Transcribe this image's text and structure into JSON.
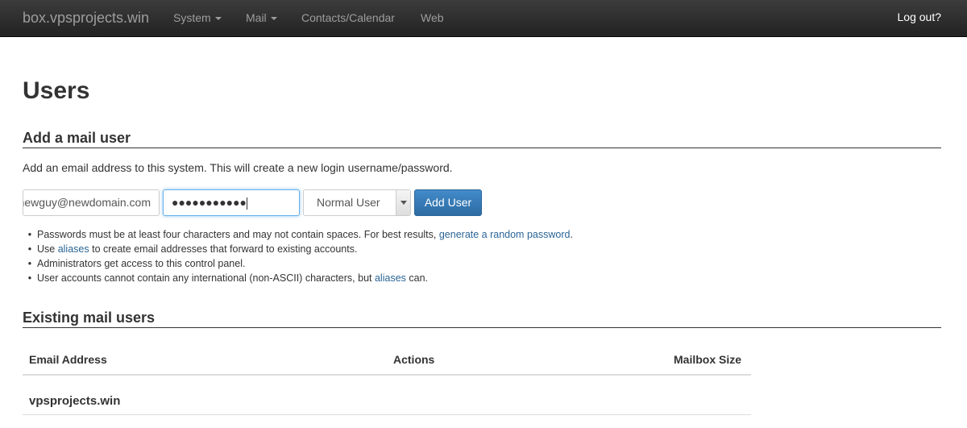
{
  "navbar": {
    "brand": "box.vpsprojects.win",
    "items": [
      {
        "label": "System",
        "dropdown": true
      },
      {
        "label": "Mail",
        "dropdown": true
      },
      {
        "label": "Contacts/Calendar",
        "dropdown": false
      },
      {
        "label": "Web",
        "dropdown": false
      }
    ],
    "logout": "Log out?"
  },
  "page": {
    "title": "Users"
  },
  "add_user": {
    "heading": "Add a mail user",
    "intro": "Add an email address to this system. This will create a new login username/password.",
    "email_value": "newguy@newdomain.com",
    "password_mask": "●●●●●●●●●●●",
    "privilege_selected": "Normal User",
    "submit_label": "Add User",
    "help": [
      {
        "before": "Passwords must be at least four characters and may not contain spaces. For best results, ",
        "link": "generate a random password",
        "after": "."
      },
      {
        "before": "Use ",
        "link": "aliases",
        "after": " to create email addresses that forward to existing accounts."
      },
      {
        "before": "Administrators get access to this control panel.",
        "link": "",
        "after": ""
      },
      {
        "before": "User accounts cannot contain any international (non-ASCII) characters, but ",
        "link": "aliases",
        "after": " can."
      }
    ]
  },
  "existing": {
    "heading": "Existing mail users",
    "columns": [
      "Email Address",
      "Actions",
      "Mailbox Size"
    ],
    "domains": [
      "vpsprojects.win"
    ]
  },
  "colors": {
    "navbar_bg": "#222222",
    "link": "#2a6496",
    "primary_button": "#428bca"
  }
}
